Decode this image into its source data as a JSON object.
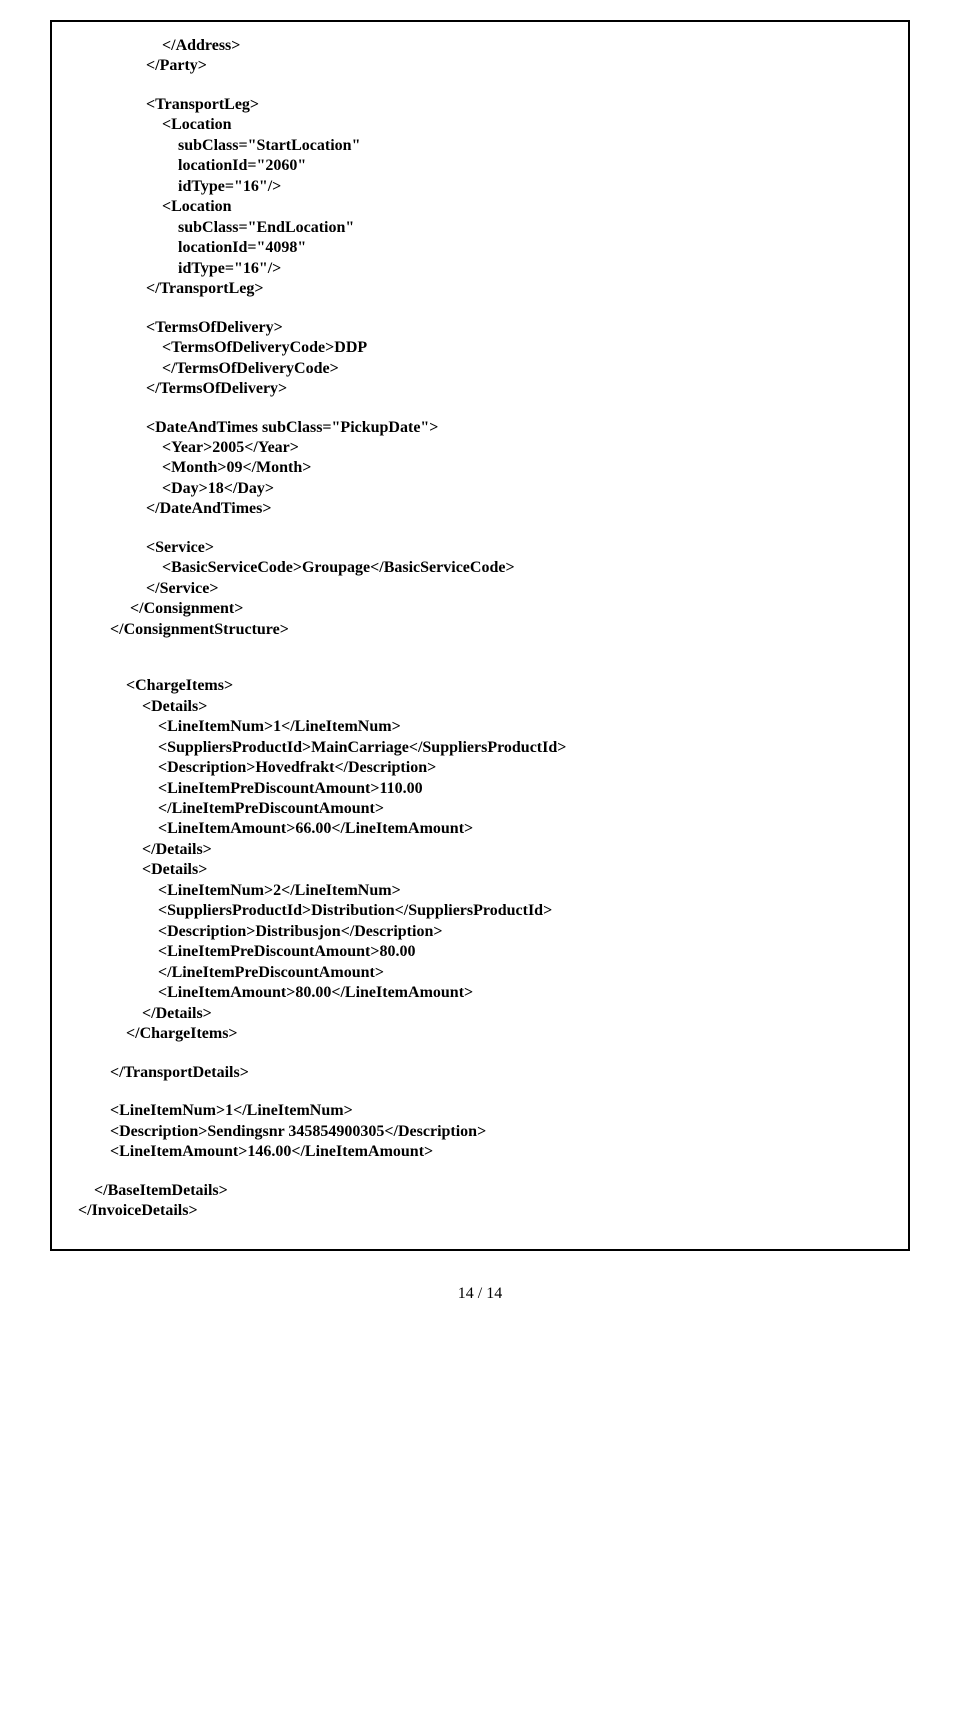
{
  "lines": {
    "l1": "</Address>",
    "l2": "</Party>",
    "l3": "<TransportLeg>",
    "l4": "<Location",
    "l5": "subClass=\"StartLocation\"",
    "l6": "locationId=\"2060\"",
    "l7": "idType=\"16\"/>",
    "l8": "<Location",
    "l9": "subClass=\"EndLocation\"",
    "l10": "locationId=\"4098\"",
    "l11": "idType=\"16\"/>",
    "l12": "</TransportLeg>",
    "l13": "<TermsOfDelivery>",
    "l14": "<TermsOfDeliveryCode>DDP",
    "l15": "</TermsOfDeliveryCode>",
    "l16": "</TermsOfDelivery>",
    "l17": "<DateAndTimes subClass=\"PickupDate\">",
    "l18": "<Year>2005</Year>",
    "l19": "<Month>09</Month>",
    "l20": "<Day>18</Day>",
    "l21": "</DateAndTimes>",
    "l22": "<Service>",
    "l23": "<BasicServiceCode>Groupage</BasicServiceCode>",
    "l24": "</Service>",
    "l25": "</Consignment>",
    "l26": "</ConsignmentStructure>",
    "l27": "<ChargeItems>",
    "l28": "<Details>",
    "l29": "<LineItemNum>1</LineItemNum>",
    "l30": "<SuppliersProductId>MainCarriage</SuppliersProductId>",
    "l31": "<Description>Hovedfrakt</Description>",
    "l32": "<LineItemPreDiscountAmount>110.00",
    "l33": "</LineItemPreDiscountAmount>",
    "l34": "<LineItemAmount>66.00</LineItemAmount>",
    "l35": "</Details>",
    "l36": "<Details>",
    "l37": "<LineItemNum>2</LineItemNum>",
    "l38": "<SuppliersProductId>Distribution</SuppliersProductId>",
    "l39": "<Description>Distribusjon</Description>",
    "l40": "<LineItemPreDiscountAmount>80.00",
    "l41": "</LineItemPreDiscountAmount>",
    "l42": "<LineItemAmount>80.00</LineItemAmount>",
    "l43": "</Details>",
    "l44": "</ChargeItems>",
    "l45": "</TransportDetails>",
    "l46": "<LineItemNum>1</LineItemNum>",
    "l47": "<Description>Sendingsnr 345854900305</Description>",
    "l48": "<LineItemAmount>146.00</LineItemAmount>",
    "l49": "</BaseItemDetails>",
    "l50": "</InvoiceDetails>"
  },
  "pagenum": "14 / 14"
}
